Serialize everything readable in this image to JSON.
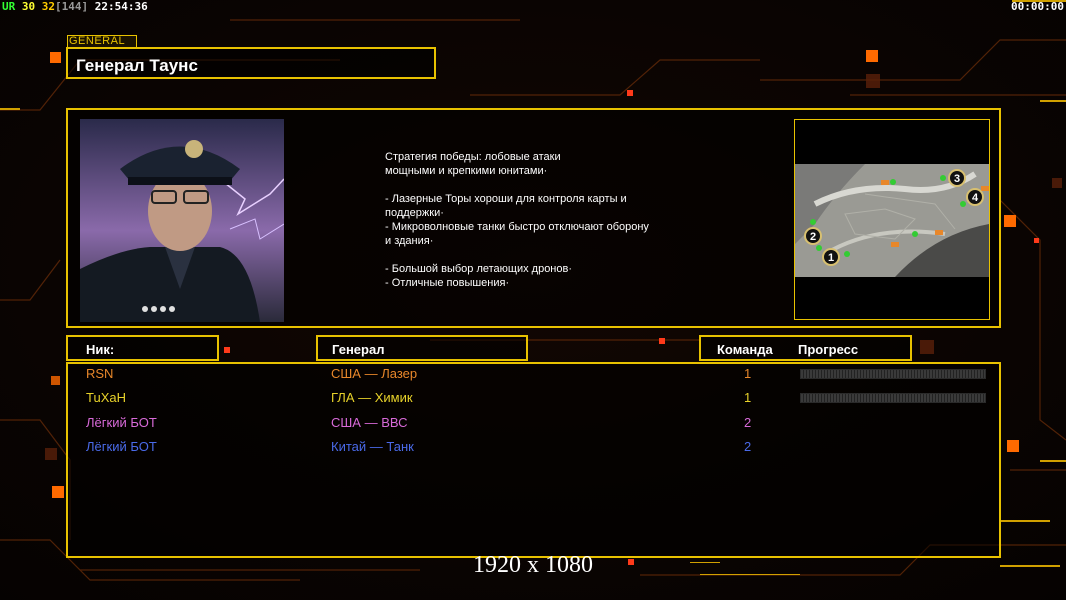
{
  "hud": {
    "ur_label": "UR",
    "fps_a": "30",
    "fps_b": "32",
    "fps_max": "[144]",
    "clock": "22:54:36",
    "timer": "00:00:00"
  },
  "section_label": "GENERAL",
  "general_name": "Генерал Таунс",
  "description": "Стратегия победы: лобовые атаки\nмощными и крепкими юнитами·\n\n- Лазерные Торы хороши для контроля карты и\n  поддержки·\n- Микроволновые танки быстро отключают оборону\n  и здания·\n\n- Большой выбор летающих дронов·\n- Отличные повышения·",
  "minimap": {
    "start_positions": [
      "1",
      "2",
      "3",
      "4"
    ]
  },
  "table": {
    "header_nick": "Ник:",
    "header_general": "Генерал",
    "header_team": "Команда",
    "header_progress": "Прогресс",
    "players": [
      {
        "nick": "RSN",
        "general": "США — Лазер",
        "team": "1",
        "color": "#e8872a",
        "has_progress": true
      },
      {
        "nick": "TuXaH",
        "general": "ГЛА — Химик",
        "team": "1",
        "color": "#e8d22a",
        "has_progress": true
      },
      {
        "nick": "Лёгкий БОТ",
        "general": "США — ВВС",
        "team": "2",
        "color": "#d86ad8",
        "has_progress": false
      },
      {
        "nick": "Лёгкий БОТ",
        "general": "Китай — Танк",
        "team": "2",
        "color": "#4a6ae8",
        "has_progress": false
      }
    ]
  },
  "resolution": "1920 x 1080",
  "colors": {
    "accent": "#e8c200",
    "glow": "#ff6a00"
  }
}
